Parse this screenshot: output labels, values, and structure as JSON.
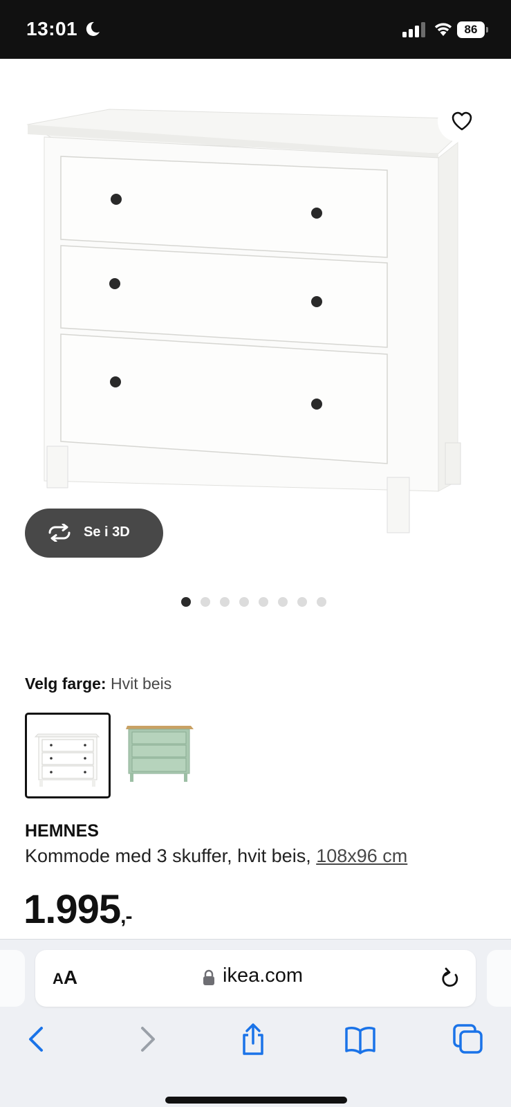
{
  "status_bar": {
    "time": "13:01",
    "battery": "86"
  },
  "product": {
    "see_3d_label": "Se i 3D",
    "image_count": 8,
    "active_image": 1,
    "color_label": "Velg farge:",
    "color_value": "Hvit beis",
    "name": "HEMNES",
    "description": "Kommode med 3 skuffer, hvit beis,",
    "size": "108x96 cm",
    "price": "1.995",
    "price_suffix": ",-"
  },
  "browser": {
    "aa_label_small": "A",
    "aa_label_large": "A",
    "domain": "ikea.com"
  },
  "colors": {
    "accent_blue": "#1a73e8",
    "dark_pill": "#484848"
  }
}
